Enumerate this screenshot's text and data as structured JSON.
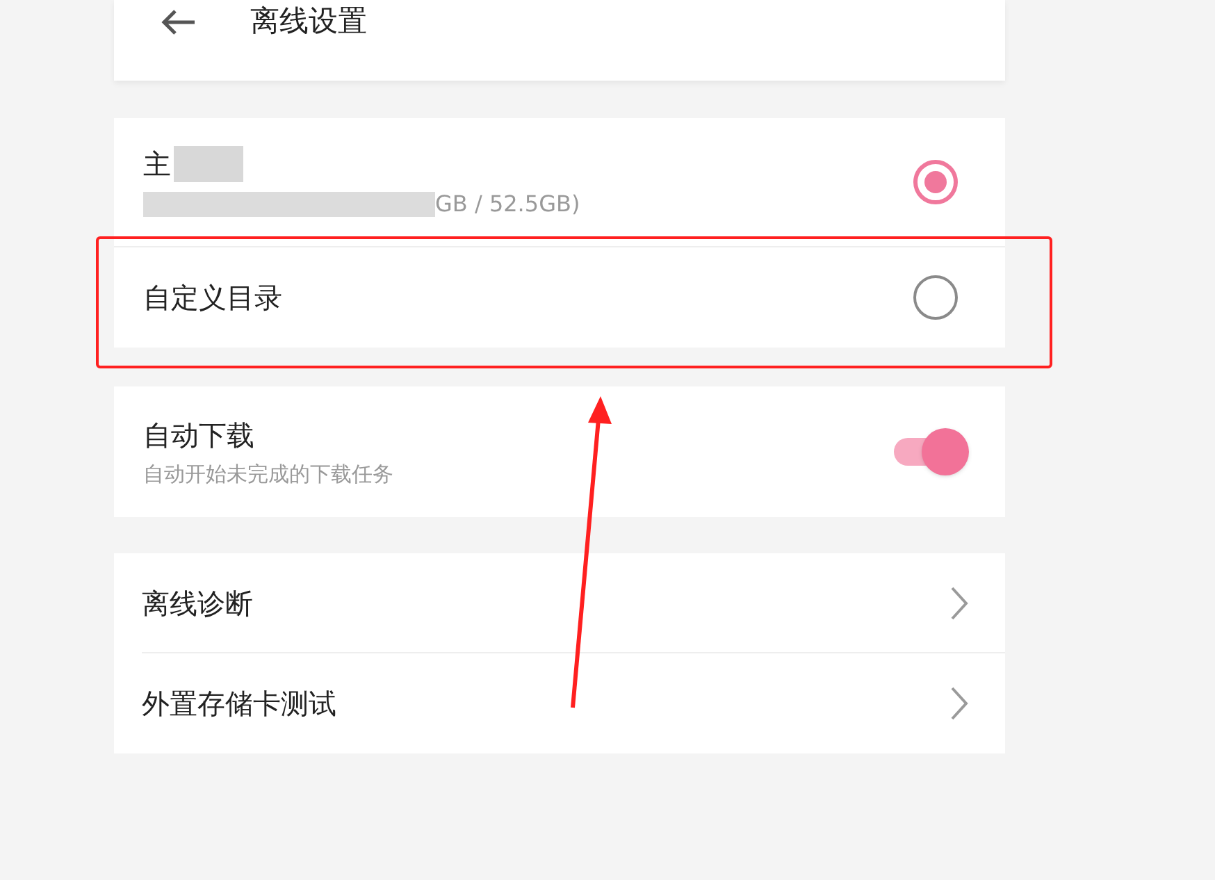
{
  "header": {
    "title": "离线设置"
  },
  "storage": [
    {
      "kind": "device",
      "label": "主",
      "detail": "GB / 52.5GB)",
      "selected": true
    },
    {
      "kind": "custom",
      "label": "自定义目录",
      "selected": false
    }
  ],
  "auto_download": {
    "label": "自动下载",
    "description": "自动开始未完成的下载任务",
    "on": true
  },
  "links": [
    {
      "label": "离线诊断"
    },
    {
      "label": "外置存储卡测试"
    }
  ]
}
